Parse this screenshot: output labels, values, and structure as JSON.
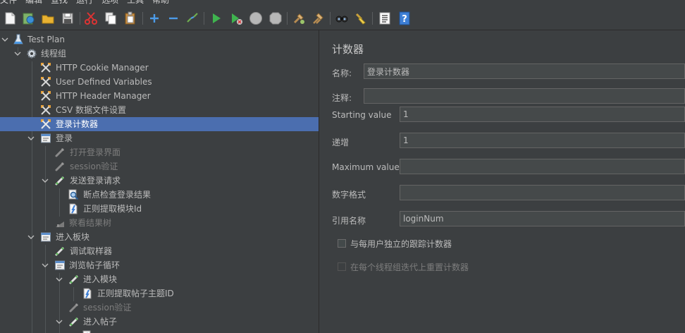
{
  "menu": [
    "文件",
    "编辑",
    "查找",
    "运行",
    "选项",
    "工具",
    "帮助"
  ],
  "toolbar": {
    "icons": [
      "new-icon",
      "templates-icon",
      "open-icon",
      "save-icon",
      "cut-icon",
      "copy-icon",
      "paste-icon",
      "expand-icon",
      "collapse-icon",
      "toggle-icon",
      "start-icon",
      "start-no-pause-icon",
      "stop-icon",
      "shutdown-icon",
      "clear-icon",
      "clear-all-icon",
      "search-icon",
      "reset-search-icon",
      "function-helper-icon",
      "help-icon"
    ]
  },
  "tree": {
    "items": [
      {
        "label": "Test Plan",
        "icon": "test-plan-icon",
        "disabled": false
      },
      {
        "label": "线程组",
        "icon": "thread-group-icon",
        "disabled": false
      },
      {
        "label": "HTTP Cookie Manager",
        "icon": "config-element-icon",
        "disabled": false
      },
      {
        "label": "User Defined Variables",
        "icon": "config-element-icon",
        "disabled": false
      },
      {
        "label": "HTTP Header Manager",
        "icon": "config-element-icon",
        "disabled": false
      },
      {
        "label": "CSV 数据文件设置",
        "icon": "config-element-icon",
        "disabled": false
      },
      {
        "label": "登录计数器",
        "icon": "config-element-icon",
        "disabled": false,
        "selected": true
      },
      {
        "label": "登录",
        "icon": "controller-icon",
        "disabled": false
      },
      {
        "label": "打开登录界面",
        "icon": "sampler-icon",
        "disabled": true
      },
      {
        "label": "session验证",
        "icon": "sampler-icon",
        "disabled": true
      },
      {
        "label": "发送登录请求",
        "icon": "sampler-icon",
        "disabled": false
      },
      {
        "label": "断点检查登录结果",
        "icon": "assertion-icon",
        "disabled": false
      },
      {
        "label": "正则提取模块Id",
        "icon": "extractor-icon",
        "disabled": false
      },
      {
        "label": "察看结果树",
        "icon": "listener-icon",
        "disabled": true
      },
      {
        "label": "进入板块",
        "icon": "controller-icon",
        "disabled": false
      },
      {
        "label": "调试取样器",
        "icon": "sampler-icon",
        "disabled": false
      },
      {
        "label": "浏览帖子循环",
        "icon": "controller-icon",
        "disabled": false
      },
      {
        "label": "进入模块",
        "icon": "sampler-icon",
        "disabled": false
      },
      {
        "label": "正则提取帖子主题ID",
        "icon": "extractor-icon",
        "disabled": false
      },
      {
        "label": "session验证",
        "icon": "sampler-icon",
        "disabled": true
      },
      {
        "label": "进入帖子",
        "icon": "sampler-icon",
        "disabled": false
      }
    ]
  },
  "panel": {
    "title": "计数器",
    "name_label": "名称:",
    "name_value": "登录计数器",
    "comment_label": "注释:",
    "comment_value": "",
    "start_label": "Starting value",
    "start_value": "1",
    "increment_label": "递增",
    "increment_value": "1",
    "max_label": "Maximum value",
    "max_value": "",
    "format_label": "数字格式",
    "format_value": "",
    "refname_label": "引用名称",
    "refname_value": "loginNum",
    "per_user_label": "与每用户独立的跟踪计数器",
    "reset_label": "在每个线程组迭代上重置计数器"
  }
}
